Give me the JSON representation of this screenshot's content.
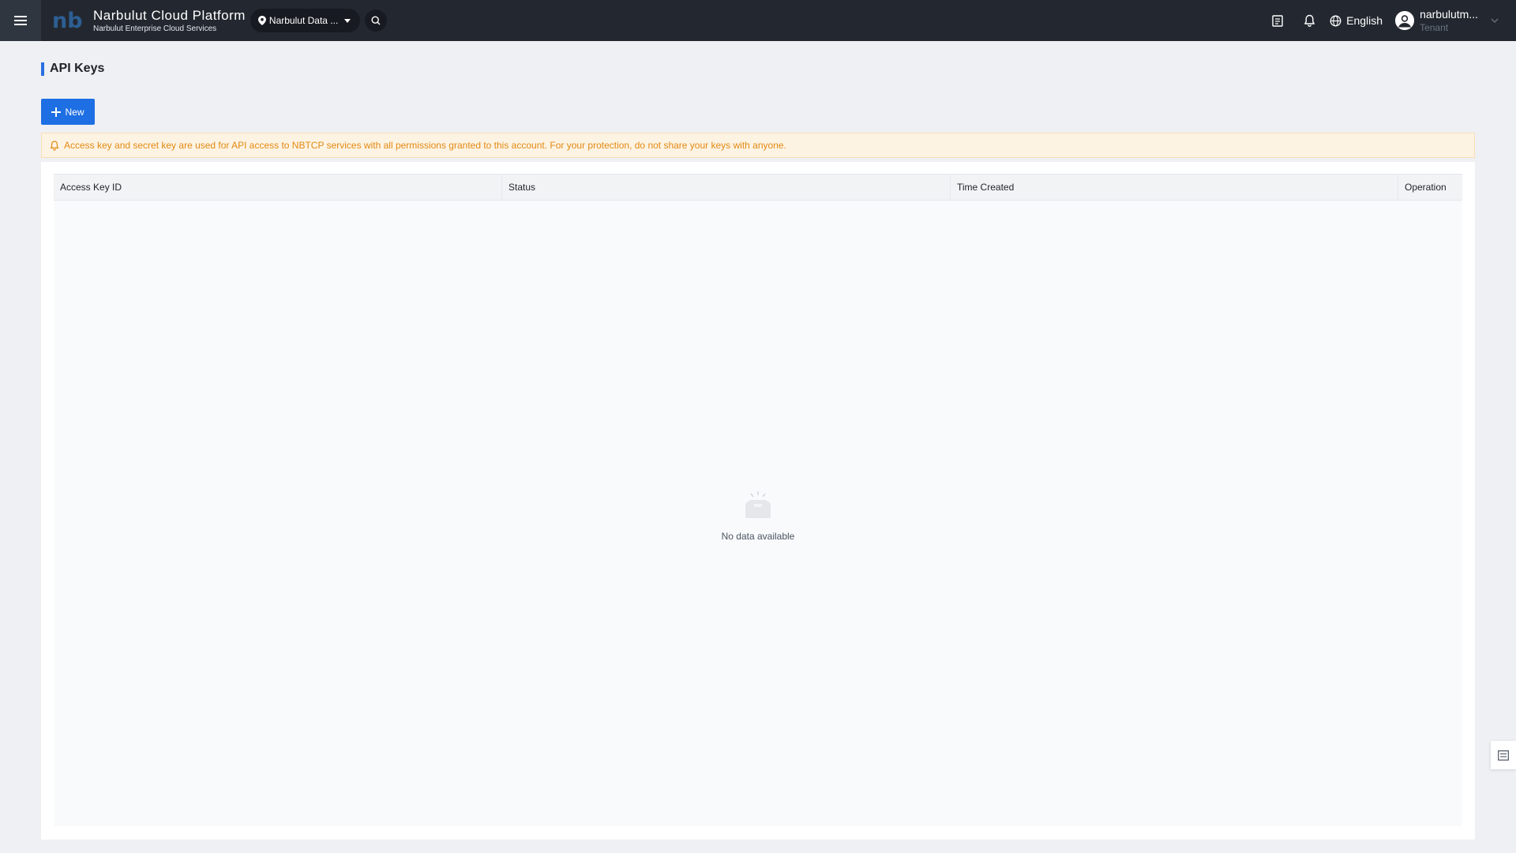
{
  "app": {
    "brand_title": "Narbulut Cloud Platform",
    "brand_subtitle": "Narbulut Enterprise Cloud Services",
    "logo_text": "nb",
    "region_label": "Narbulut Data ..."
  },
  "header": {
    "language": "English",
    "user_name": "narbulutm...",
    "user_role": "Tenant"
  },
  "page": {
    "title": "API Keys",
    "new_button_label": "New",
    "notice": "Access key and secret key are used for API access to NBTCP services with all permissions granted to this account. For your protection, do not share your keys with anyone."
  },
  "table": {
    "columns": [
      "Access Key ID",
      "Status",
      "Time Created",
      "Operation"
    ],
    "rows": [],
    "empty_text": "No data available"
  },
  "colors": {
    "topbar": "#232830",
    "primary": "#1e6fe3",
    "warning_text": "#e28a12",
    "warning_bg": "#fdf3e3"
  },
  "icons": {
    "menu": "hamburger-icon",
    "region": "location-pin-icon",
    "search": "search-icon",
    "notes": "document-icon",
    "notifications": "bell-icon",
    "language": "globe-icon",
    "user": "user-avatar-icon",
    "new": "plus-icon",
    "notice": "bell-icon",
    "empty": "empty-inbox-icon",
    "side": "list-icon"
  }
}
